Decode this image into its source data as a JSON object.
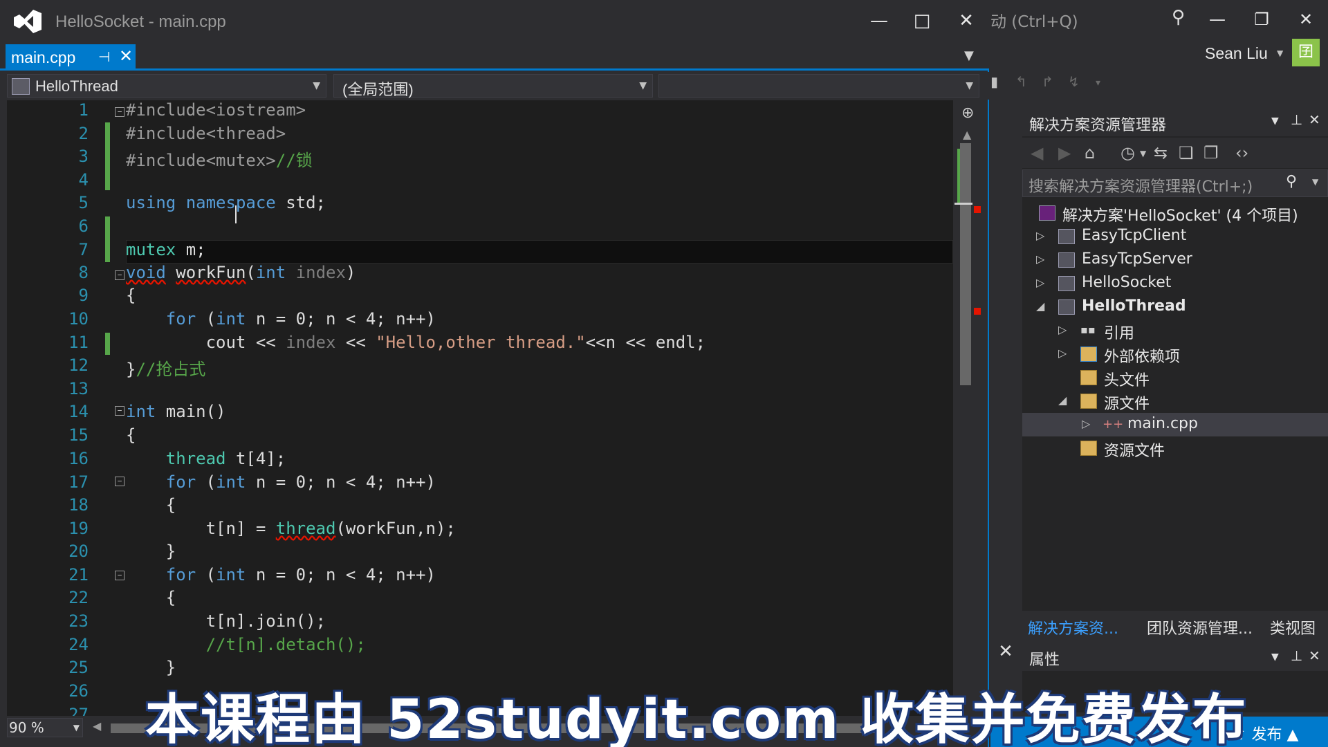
{
  "window": {
    "title": "HelloSocket - main.cpp",
    "minimize": "—",
    "maximize": "□",
    "close": "✕"
  },
  "tabs": [
    {
      "label": "main.cpp",
      "pin_icon": "pin-icon",
      "close_icon": "close-icon"
    }
  ],
  "navbar": {
    "project": "HelloThread",
    "scope": "(全局范围)",
    "member": ""
  },
  "editor": {
    "lines": [
      {
        "n": "1",
        "fold": "-"
      },
      {
        "n": "2"
      },
      {
        "n": "3"
      },
      {
        "n": "4"
      },
      {
        "n": "5"
      },
      {
        "n": "6"
      },
      {
        "n": "7"
      },
      {
        "n": "8",
        "fold": "-"
      },
      {
        "n": "9"
      },
      {
        "n": "10"
      },
      {
        "n": "11"
      },
      {
        "n": "12"
      },
      {
        "n": "13"
      },
      {
        "n": "14",
        "fold": "-"
      },
      {
        "n": "15"
      },
      {
        "n": "16"
      },
      {
        "n": "17",
        "fold": "-"
      },
      {
        "n": "18"
      },
      {
        "n": "19"
      },
      {
        "n": "20"
      },
      {
        "n": "21",
        "fold": "-"
      },
      {
        "n": "22"
      },
      {
        "n": "23"
      },
      {
        "n": "24"
      },
      {
        "n": "25"
      },
      {
        "n": "26"
      },
      {
        "n": "27"
      }
    ],
    "code": {
      "l1": "#include<iostream>",
      "l2": "#include<thread>",
      "l3a": "#include<mutex>",
      "l3b": "//锁",
      "l5a": "using",
      "l5b": "namespace",
      "l5c": " std;",
      "l7a": "mutex",
      "l7b": " m;",
      "l8a": "void",
      "l8b": "workFun",
      "l8c": "(",
      "l8d": "int",
      "l8e": "index",
      "l8f": ")",
      "l9": "{",
      "l10a": "for",
      "l10b": " (",
      "l10c": "int",
      "l10d": " n = 0; n < 4; n++)",
      "l11a": "cout << ",
      "l11b": "index",
      "l11c": " << ",
      "l11d": "\"Hello,other thread.\"",
      "l11e": "<<n << endl;",
      "l12a": "}",
      "l12b": "//抢占式",
      "l14a": "int",
      "l14b": " main()",
      "l15": "{",
      "l16a": "thread",
      "l16b": " t[4];",
      "l17a": "for",
      "l17b": " (",
      "l17c": "int",
      "l17d": " n = 0; n < 4; n++)",
      "l18": "{",
      "l19a": "t[n] = ",
      "l19b": "thread",
      "l19c": "(workFun,n);",
      "l20": "}",
      "l21a": "for",
      "l21b": " (",
      "l21c": "int",
      "l21d": " n = 0; n < 4; n++)",
      "l22": "{",
      "l23": "t[n].join();",
      "l24": "//t[n].detach();",
      "l25": "}",
      "l27": "<"
    },
    "zoom": "90 %"
  },
  "quick_launch": {
    "placeholder": "动 (Ctrl+Q)"
  },
  "user": {
    "name": "Sean Liu",
    "avatar_glyph": "囝"
  },
  "solution_explorer": {
    "title": "解决方案资源管理器",
    "search_placeholder": "搜索解决方案资源管理器(Ctrl+;)",
    "tree": [
      {
        "label": "解决方案'HelloSocket' (4 个项目)"
      },
      {
        "label": "EasyTcpClient"
      },
      {
        "label": "EasyTcpServer"
      },
      {
        "label": "HelloSocket"
      },
      {
        "label": "HelloThread"
      },
      {
        "label": "引用"
      },
      {
        "label": "外部依赖项"
      },
      {
        "label": "头文件"
      },
      {
        "label": "源文件"
      },
      {
        "label": "main.cpp"
      },
      {
        "label": "资源文件"
      }
    ],
    "bottom_tabs": [
      "解决方案资...",
      "团队资源管理...",
      "类视图"
    ]
  },
  "properties": {
    "title": "属性"
  },
  "status": {
    "publish": "发布"
  },
  "watermark": "本课程由 52studyit.com 收集并免费发布",
  "colors": {
    "accent": "#007acc",
    "editor_bg": "#1e1e1e",
    "keyword": "#569cd6",
    "type": "#4ec9b0",
    "string": "#d69d85",
    "comment": "#57a64a"
  }
}
